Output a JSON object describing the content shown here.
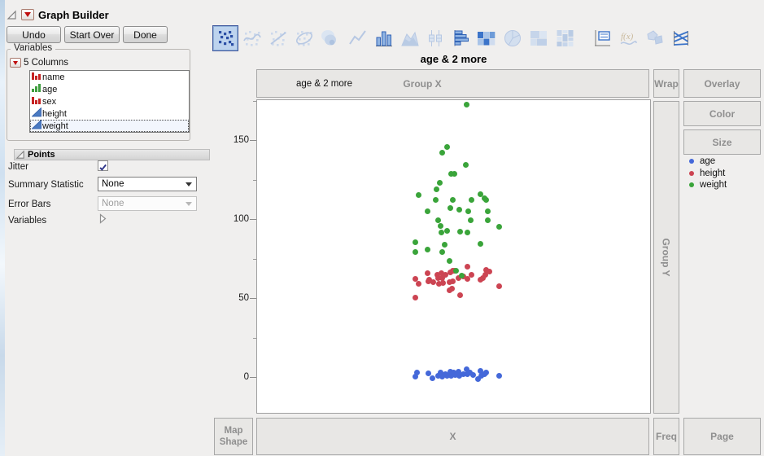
{
  "window": {
    "title": "Graph Builder"
  },
  "controls": {
    "undo": "Undo",
    "start_over": "Start Over",
    "done": "Done"
  },
  "variables_panel": {
    "legend": "Variables",
    "header": "5 Columns",
    "items": [
      {
        "name": "name",
        "type": "nominal",
        "selected": false
      },
      {
        "name": "age",
        "type": "ordinal",
        "selected": false
      },
      {
        "name": "sex",
        "type": "nominal",
        "selected": false
      },
      {
        "name": "height",
        "type": "continuous",
        "selected": false
      },
      {
        "name": "weight",
        "type": "continuous",
        "selected": true
      }
    ]
  },
  "points_panel": {
    "title": "Points",
    "jitter_label": "Jitter",
    "jitter_checked": true,
    "summary_label": "Summary Statistic",
    "summary_value": "None",
    "error_label": "Error Bars",
    "error_value": "None",
    "error_enabled": false,
    "variables_label": "Variables"
  },
  "toolbar": {
    "icons": [
      {
        "name": "points-icon",
        "state": "selected"
      },
      {
        "name": "smoother-icon",
        "state": "dim"
      },
      {
        "name": "line-of-fit-icon",
        "state": "dim"
      },
      {
        "name": "ellipse-icon",
        "state": "dim"
      },
      {
        "name": "contour-icon",
        "state": "dim"
      },
      {
        "name": "line-icon",
        "state": "dim"
      },
      {
        "name": "bar-icon",
        "state": "enabled"
      },
      {
        "name": "area-icon",
        "state": "dim"
      },
      {
        "name": "box-plot-icon",
        "state": "dim"
      },
      {
        "name": "histogram-icon",
        "state": "enabled"
      },
      {
        "name": "heatmap-icon",
        "state": "enabled"
      },
      {
        "name": "pie-icon",
        "state": "dim"
      },
      {
        "name": "treemap-icon",
        "state": "dim"
      },
      {
        "name": "mosaic-icon",
        "state": "dim"
      },
      {
        "name": "caption-box-icon",
        "state": "enabled"
      },
      {
        "name": "formula-icon",
        "state": "dim"
      },
      {
        "name": "map-shapes-icon",
        "state": "dim"
      },
      {
        "name": "parallel-icon",
        "state": "enabled"
      }
    ]
  },
  "graph": {
    "title": "age & 2 more",
    "group_x_label": "age & 2 more",
    "group_x_hint": "Group X",
    "zones": {
      "wrap": "Wrap",
      "overlay": "Overlay",
      "color": "Color",
      "size": "Size",
      "group_y": "Group Y",
      "map_shape": "Map Shape",
      "x": "X",
      "freq": "Freq",
      "page": "Page"
    },
    "legend": [
      {
        "label": "age",
        "color": "#4468d9"
      },
      {
        "label": "height",
        "color": "#cc4452"
      },
      {
        "label": "weight",
        "color": "#3aa43a"
      }
    ]
  },
  "chart_data": {
    "type": "scatter",
    "title": "age & 2 more",
    "xlabel": "",
    "ylabel": "",
    "ylim": [
      -23.2,
      175.8
    ],
    "yticks": [
      0,
      50,
      100,
      150
    ],
    "yticks_minor": [
      25,
      75,
      125,
      175
    ],
    "grid": false,
    "legend_position": "right",
    "jitter": true,
    "series": [
      {
        "name": "age",
        "color": "#4468d9",
        "points": [
          [
            0.4,
            0.7
          ],
          [
            0.406,
            3.2
          ],
          [
            0.435,
            2.8
          ],
          [
            0.445,
            -0.3
          ],
          [
            0.458,
            1.5
          ],
          [
            0.464,
            3.6
          ],
          [
            0.47,
            0.7
          ],
          [
            0.478,
            2.4
          ],
          [
            0.482,
            1.5
          ],
          [
            0.489,
            4.1
          ],
          [
            0.491,
            1.1
          ],
          [
            0.497,
            3.2
          ],
          [
            0.503,
            1.9
          ],
          [
            0.511,
            4.1
          ],
          [
            0.513,
            1.1
          ],
          [
            0.522,
            2.4
          ],
          [
            0.53,
            5.2
          ],
          [
            0.532,
            2.4
          ],
          [
            0.54,
            3.6
          ],
          [
            0.548,
            1.9
          ],
          [
            0.559,
            -0.8
          ],
          [
            0.565,
            4.6
          ],
          [
            0.569,
            1.5
          ],
          [
            0.577,
            2.4
          ],
          [
            0.581,
            3.6
          ],
          [
            0.614,
            1.1
          ]
        ]
      },
      {
        "name": "height",
        "color": "#cc4452",
        "points": [
          [
            0.532,
            70.6
          ],
          [
            0.499,
            68.0
          ],
          [
            0.489,
            67.0
          ],
          [
            0.581,
            68.5
          ],
          [
            0.588,
            67.5
          ],
          [
            0.431,
            66.0
          ],
          [
            0.456,
            65.4
          ],
          [
            0.466,
            66.0
          ],
          [
            0.478,
            65.4
          ],
          [
            0.495,
            68.0
          ],
          [
            0.458,
            63.4
          ],
          [
            0.47,
            62.9
          ],
          [
            0.437,
            61.9
          ],
          [
            0.447,
            60.8
          ],
          [
            0.46,
            59.8
          ],
          [
            0.472,
            60.3
          ],
          [
            0.487,
            60.8
          ],
          [
            0.495,
            61.3
          ],
          [
            0.511,
            63.4
          ],
          [
            0.522,
            64.4
          ],
          [
            0.534,
            62.4
          ],
          [
            0.544,
            65.4
          ],
          [
            0.565,
            61.9
          ],
          [
            0.573,
            62.9
          ],
          [
            0.579,
            65.4
          ],
          [
            0.402,
            62.4
          ],
          [
            0.41,
            59.3
          ],
          [
            0.433,
            61.3
          ],
          [
            0.493,
            56.2
          ],
          [
            0.487,
            55.2
          ],
          [
            0.614,
            58.2
          ],
          [
            0.4,
            51.0
          ],
          [
            0.515,
            52.1
          ]
        ]
      },
      {
        "name": "weight",
        "color": "#3aa43a",
        "points": [
          [
            0.53,
            173.0
          ],
          [
            0.482,
            146.4
          ],
          [
            0.47,
            142.8
          ],
          [
            0.528,
            135.0
          ],
          [
            0.491,
            129.4
          ],
          [
            0.501,
            129.4
          ],
          [
            0.462,
            123.7
          ],
          [
            0.454,
            119.6
          ],
          [
            0.41,
            115.5
          ],
          [
            0.452,
            112.9
          ],
          [
            0.495,
            112.9
          ],
          [
            0.544,
            112.9
          ],
          [
            0.567,
            116.5
          ],
          [
            0.577,
            113.9
          ],
          [
            0.581,
            112.4
          ],
          [
            0.489,
            107.7
          ],
          [
            0.513,
            106.7
          ],
          [
            0.431,
            105.2
          ],
          [
            0.536,
            105.2
          ],
          [
            0.584,
            105.2
          ],
          [
            0.458,
            100.0
          ],
          [
            0.542,
            99.5
          ],
          [
            0.584,
            100.0
          ],
          [
            0.464,
            95.9
          ],
          [
            0.482,
            93.3
          ],
          [
            0.466,
            91.8
          ],
          [
            0.515,
            92.3
          ],
          [
            0.532,
            91.8
          ],
          [
            0.614,
            95.4
          ],
          [
            0.402,
            85.6
          ],
          [
            0.476,
            84.5
          ],
          [
            0.567,
            85.0
          ],
          [
            0.4,
            79.4
          ],
          [
            0.431,
            81.4
          ],
          [
            0.47,
            79.9
          ],
          [
            0.487,
            74.2
          ],
          [
            0.505,
            68.0
          ],
          [
            0.518,
            64.5
          ]
        ]
      }
    ]
  }
}
